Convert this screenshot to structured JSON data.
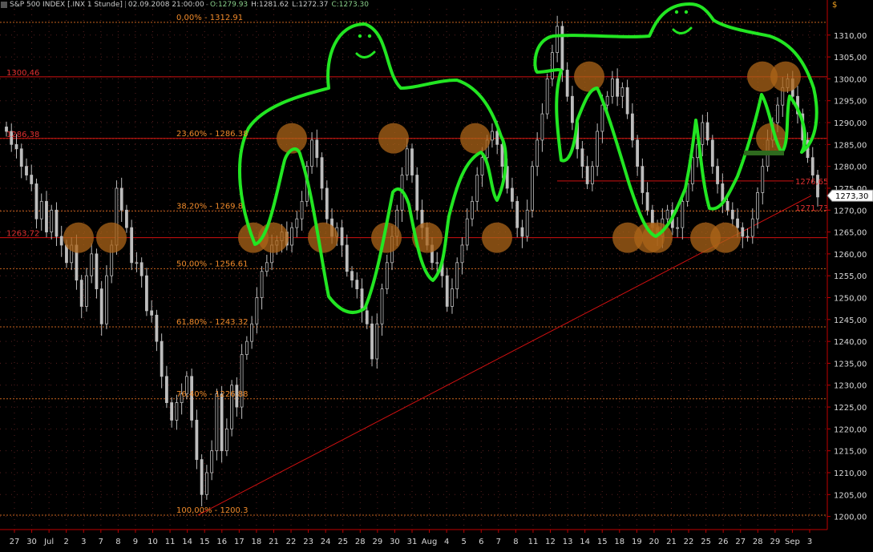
{
  "header": {
    "title": "S&P 500 INDEX [.INX 1 Stunde]",
    "datetime": "02.09.2008 21:00:00",
    "open": "O:1279.93",
    "high": "H:1281.62",
    "low": "L:1272.37",
    "close": "C:1273.30"
  },
  "currency_label": "$",
  "colors": {
    "background": "#000000",
    "candles": "#bdbdbd",
    "fib_line": "#c8641e",
    "fib_text": "#f08a2a",
    "red_line": "#d01010",
    "red_text": "#e03030",
    "axis": "#c00000",
    "doodle": "#22e622",
    "circle": "#ac6418",
    "grid_dot": "#5a2020"
  },
  "chart_data": {
    "type": "candlestick",
    "ylim": [
      1197,
      1316
    ],
    "y_ticks": [
      "1200,00",
      "1205,00",
      "1210,00",
      "1215,00",
      "1220,00",
      "1225,00",
      "1230,00",
      "1235,00",
      "1240,00",
      "1245,00",
      "1250,00",
      "1255,00",
      "1260,00",
      "1265,00",
      "1270,00",
      "1275,00",
      "1280,00",
      "1285,00",
      "1290,00",
      "1295,00",
      "1300,00",
      "1305,00",
      "1310,00"
    ],
    "x_labels": [
      "27",
      "30",
      "Jul",
      "2",
      "3",
      "7",
      "8",
      "9",
      "10",
      "11",
      "14",
      "15",
      "16",
      "17",
      "18",
      "21",
      "22",
      "23",
      "24",
      "25",
      "28",
      "29",
      "30",
      "31",
      "Aug",
      "4",
      "5",
      "6",
      "7",
      "8",
      "11",
      "12",
      "13",
      "14",
      "15",
      "18",
      "19",
      "20",
      "21",
      "22",
      "25",
      "26",
      "27",
      "28",
      "29",
      "Sep",
      "3"
    ],
    "fib_levels": [
      {
        "label": "0,00% - 1312.91",
        "value": 1312.91
      },
      {
        "label": "23,60% - 1286.38",
        "value": 1286.38
      },
      {
        "label": "38,20% - 1269.8",
        "value": 1269.8
      },
      {
        "label": "50,00% - 1256.61",
        "value": 1256.61
      },
      {
        "label": "61,80% - 1243.32",
        "value": 1243.32
      },
      {
        "label": "76,40% - 1226.88",
        "value": 1226.88
      },
      {
        "label": "100,00% - 1200.3",
        "value": 1200.3
      }
    ],
    "horizontal_lines": [
      {
        "label": "1300,46",
        "value": 1300.46
      },
      {
        "label": "1286,38",
        "value": 1286.38
      },
      {
        "label": "1263,72",
        "value": 1263.72
      }
    ],
    "short_lines": [
      {
        "label": "1276,65",
        "value": 1276.65
      },
      {
        "label": "1271,73",
        "value": 1271.73
      }
    ],
    "last_price": "1273,30",
    "last_value": 1273.3,
    "trendline": {
      "from": 1200.3,
      "to": 1273.3
    },
    "close_path": [
      1288,
      1285,
      1284,
      1280,
      1278,
      1276,
      1268,
      1272,
      1265,
      1270,
      1264,
      1262,
      1258,
      1262,
      1254,
      1248,
      1255,
      1260,
      1252,
      1244,
      1255,
      1262,
      1275,
      1270,
      1266,
      1258,
      1258,
      1255,
      1247,
      1246,
      1240,
      1232,
      1226,
      1222,
      1226,
      1228,
      1232,
      1222,
      1213,
      1205,
      1210,
      1215,
      1228,
      1215,
      1220,
      1230,
      1225,
      1237,
      1240,
      1244,
      1250,
      1256,
      1258,
      1262,
      1263,
      1265,
      1262,
      1266,
      1268,
      1272,
      1280,
      1286,
      1282,
      1275,
      1268,
      1264,
      1266,
      1262,
      1256,
      1254,
      1252,
      1247,
      1244,
      1236,
      1244,
      1252,
      1258,
      1264,
      1270,
      1278,
      1284,
      1278,
      1270,
      1266,
      1262,
      1258,
      1258,
      1255,
      1248,
      1252,
      1258,
      1262,
      1268,
      1272,
      1278,
      1282,
      1286,
      1288,
      1285,
      1280,
      1275,
      1272,
      1266,
      1264,
      1270,
      1280,
      1286,
      1292,
      1300,
      1306,
      1312,
      1302,
      1296,
      1290,
      1284,
      1280,
      1276,
      1280,
      1288,
      1294,
      1296,
      1300,
      1296,
      1298,
      1292,
      1286,
      1280,
      1274,
      1270,
      1266,
      1264,
      1268,
      1270,
      1266,
      1266,
      1272,
      1276,
      1282,
      1285,
      1290,
      1286,
      1280,
      1276,
      1272,
      1270,
      1268,
      1266,
      1264,
      1264,
      1268,
      1274,
      1280,
      1286,
      1290,
      1294,
      1298,
      1300,
      1296,
      1292,
      1286,
      1282,
      1278,
      1273
    ]
  }
}
